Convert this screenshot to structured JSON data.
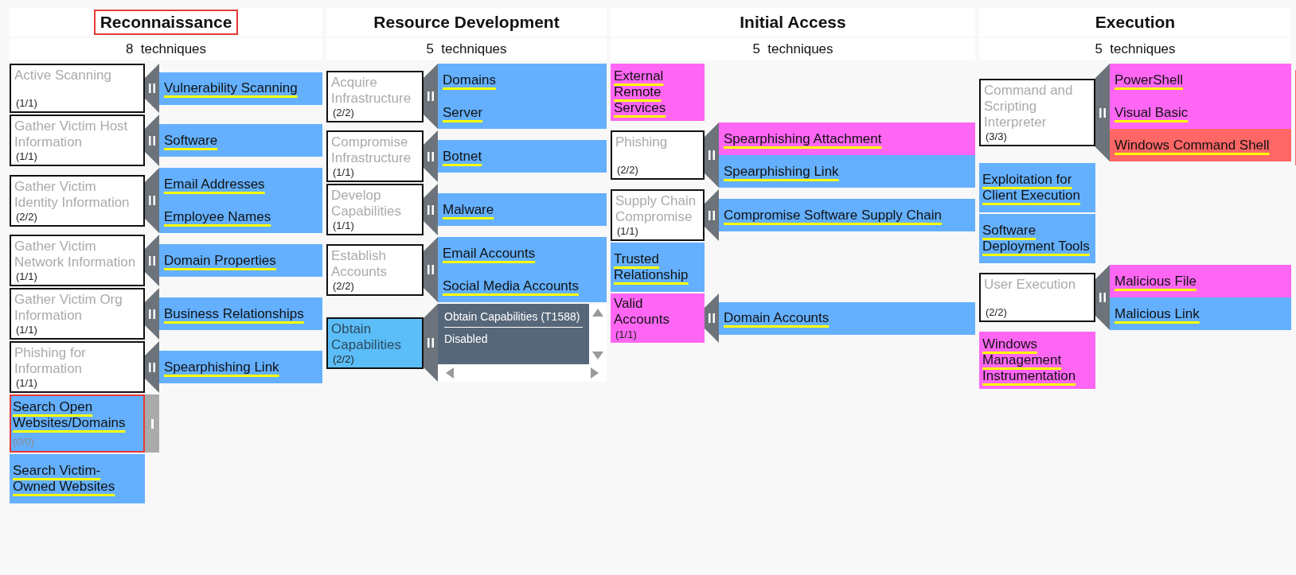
{
  "tactics": [
    {
      "name": "Reconnaissance",
      "highlighted": true,
      "count": "8  techniques",
      "techniques": [
        {
          "kind": "parent",
          "name": "Active Scanning",
          "count": "(1/1)",
          "selected": false,
          "subtechniques": [
            {
              "name": "Vulnerability Scanning",
              "color": "#64b0fe"
            }
          ]
        },
        {
          "kind": "parent",
          "name": "Gather Victim Host Information",
          "count": "(1/1)",
          "selected": false,
          "subtechniques": [
            {
              "name": "Software",
              "color": "#64b0fe"
            }
          ]
        },
        {
          "kind": "parent",
          "name": "Gather Victim Identity Information",
          "count": "(2/2)",
          "selected": false,
          "subtechniques": [
            {
              "name": "Email Addresses",
              "color": "#64b0fe"
            },
            {
              "name": "Employee Names",
              "color": "#64b0fe"
            }
          ]
        },
        {
          "kind": "parent",
          "name": "Gather Victim Network Information",
          "count": "(1/1)",
          "selected": false,
          "subtechniques": [
            {
              "name": "Domain Properties",
              "color": "#64b0fe"
            }
          ]
        },
        {
          "kind": "parent",
          "name": "Gather Victim Org Information",
          "count": "(1/1)",
          "selected": false,
          "subtechniques": [
            {
              "name": "Business Relationships",
              "color": "#64b0fe"
            }
          ]
        },
        {
          "kind": "parent",
          "name": "Phishing for Information",
          "count": "(1/1)",
          "selected": false,
          "subtechniques": [
            {
              "name": "Spearphishing Link",
              "color": "#64b0fe"
            }
          ]
        },
        {
          "kind": "collapsed",
          "name": "Search Open Websites/Domains",
          "count": "(0/0)",
          "color": "#64b0fe",
          "highlighted": true
        },
        {
          "kind": "technique",
          "name": "Search Victim-Owned Websites",
          "color": "#64b0fe"
        }
      ]
    },
    {
      "name": "Resource Development",
      "highlighted": false,
      "count": "5  techniques",
      "techniques": [
        {
          "kind": "parent",
          "name": "Acquire Infrastructure",
          "count": "(2/2)",
          "selected": false,
          "subtechniques": [
            {
              "name": "Domains",
              "color": "#64b0fe"
            },
            {
              "name": "Server",
              "color": "#64b0fe"
            }
          ]
        },
        {
          "kind": "parent",
          "name": "Compromise Infrastructure",
          "count": "(1/1)",
          "selected": false,
          "subtechniques": [
            {
              "name": "Botnet",
              "color": "#64b0fe"
            }
          ]
        },
        {
          "kind": "parent",
          "name": "Develop Capabilities",
          "count": "(1/1)",
          "selected": false,
          "subtechniques": [
            {
              "name": "Malware",
              "color": "#64b0fe"
            }
          ]
        },
        {
          "kind": "parent",
          "name": "Establish Accounts",
          "count": "(2/2)",
          "selected": false,
          "subtechniques": [
            {
              "name": "Email Accounts",
              "color": "#64b0fe"
            },
            {
              "name": "Social Media Accounts",
              "color": "#64b0fe"
            }
          ]
        },
        {
          "kind": "parent",
          "name": "Obtain Capabilities",
          "count": "(2/2)",
          "selected": true,
          "tooltip": {
            "title": "Obtain Capabilities (T1588)",
            "status": "Disabled"
          }
        }
      ]
    },
    {
      "name": "Initial Access",
      "highlighted": false,
      "count": "5  techniques",
      "techniques": [
        {
          "kind": "technique",
          "name": "External Remote Services",
          "color": "#ff66f4"
        },
        {
          "kind": "parent",
          "name": "Phishing",
          "count": "(2/2)",
          "selected": false,
          "subtechniques": [
            {
              "name": "Spearphishing Attachment",
              "color": "#ff66f4"
            },
            {
              "name": "Spearphishing Link",
              "color": "#64b0fe"
            }
          ]
        },
        {
          "kind": "parent",
          "name": "Supply Chain Compromise",
          "count": "(1/1)",
          "selected": false,
          "subtechniques": [
            {
              "name": "Compromise Software Supply Chain",
              "color": "#64b0fe"
            }
          ]
        },
        {
          "kind": "technique",
          "name": "Trusted Relationship",
          "color": "#64b0fe"
        },
        {
          "kind": "parent",
          "name": "Valid Accounts",
          "count": "(1/1)",
          "selected": false,
          "color": "#ff66f4",
          "subtechniques": [
            {
              "name": "Domain Accounts",
              "color": "#64b0fe"
            }
          ]
        }
      ]
    },
    {
      "name": "Execution",
      "highlighted": false,
      "count": "5  techniques",
      "techniques": [
        {
          "kind": "parent",
          "name": "Command and Scripting Interpreter",
          "count": "(3/3)",
          "selected": false,
          "subtechniques": [
            {
              "name": "PowerShell",
              "color": "#ff66f4"
            },
            {
              "name": "Visual Basic",
              "color": "#ff66f4"
            },
            {
              "name": "Windows Command Shell",
              "color": "#ff6666"
            }
          ]
        },
        {
          "kind": "technique",
          "name": "Exploitation for Client Execution",
          "color": "#64b0fe"
        },
        {
          "kind": "technique",
          "name": "Software Deployment Tools",
          "color": "#64b0fe"
        },
        {
          "kind": "parent",
          "name": "User Execution",
          "count": "(2/2)",
          "selected": false,
          "subtechniques": [
            {
              "name": "Malicious File",
              "color": "#ff66f4"
            },
            {
              "name": "Malicious Link",
              "color": "#64b0fe"
            }
          ]
        },
        {
          "kind": "technique",
          "name": "Windows Management Instrumentation",
          "color": "#ff66f4"
        }
      ]
    }
  ]
}
